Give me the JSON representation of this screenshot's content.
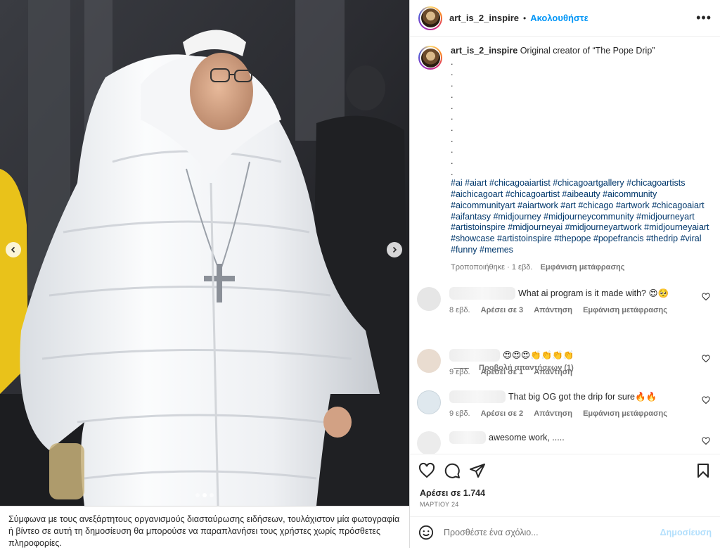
{
  "post": {
    "username": "art_is_2_inspire",
    "separator": "•",
    "follow_label": "Ακολουθήστε",
    "more_label": "•••"
  },
  "caption": {
    "username": "art_is_2_inspire",
    "text": "Original creator of “The Pope Drip”",
    "dots": [
      ".",
      ".",
      ".",
      ".",
      ".",
      ".",
      ".",
      ".",
      ".",
      ".",
      "."
    ],
    "hashtags": "#ai #aiart #chicagoaiartist #chicagoartgallery #chicagoartists #aichicagoart #chicagoartist #aibeauty #aicommunity #aicommunityart #aiartwork #art #chicago #artwork #chicagoaiart #aifantasy #midjourney #midjourneycommunity #midjourneyart #artistoinspire #midjourneyai #midjourneyartwork #midjourneyaiart #showcase #artistoinspire #thepope #popefrancis #thedrip #viral #funny #memes",
    "edited_label": "Τροποποιήθηκε · 1 εβδ.",
    "translate_label": "Εμφάνιση μετάφρασης"
  },
  "comments": [
    {
      "text": "What ai program is it made with? 😍🥺",
      "time": "8 εβδ.",
      "likes": "Αρέσει σε 3",
      "reply": "Απάντηση",
      "translate": "Εμφάνιση μετάφρασης"
    },
    {
      "text": "😍😍😍👏👏👏👏",
      "time": "9 εβδ.",
      "likes": "Αρέσει σε 1",
      "reply": "Απάντηση",
      "translate": ""
    },
    {
      "text": "That big OG got the drip for sure🔥🔥",
      "time": "9 εβδ.",
      "likes": "Αρέσει σε 2",
      "reply": "Απάντηση",
      "translate": "Εμφάνιση μετάφρασης"
    },
    {
      "text": "awesome work, .....",
      "time": "",
      "likes": "",
      "reply": "",
      "translate": ""
    }
  ],
  "view_replies_label": "Προβολή απαντήσεων (1)",
  "likes_label": "Αρέσει σε 1.744",
  "date_label": "ΜΑΡΤΙΟΥ 24",
  "comment_input": {
    "placeholder": "Προσθέστε ένα σχόλιο...",
    "value": ""
  },
  "post_button_label": "Δημοσίευση",
  "disclaimer": "Σύμφωνα με τους ανεξάρτητους οργανισμούς διασταύρωσης ειδήσεων, τουλάχιστον μία φωτογραφία ή βίντεο σε αυτή τη δημοσίευση θα μπορούσε να παραπλανήσει τους χρήστες χωρίς πρόσθετες πληροφορίες.",
  "carousel": {
    "slides": 3,
    "active": 1
  },
  "colors": {
    "accent": "#0095f6",
    "link": "#00376b",
    "muted": "#737373",
    "post_disabled": "#b2dffc"
  },
  "icons": [
    "heart-icon",
    "comment-icon",
    "share-icon",
    "save-icon",
    "emoji-icon",
    "chevron-left-icon",
    "chevron-right-icon",
    "more-icon"
  ]
}
